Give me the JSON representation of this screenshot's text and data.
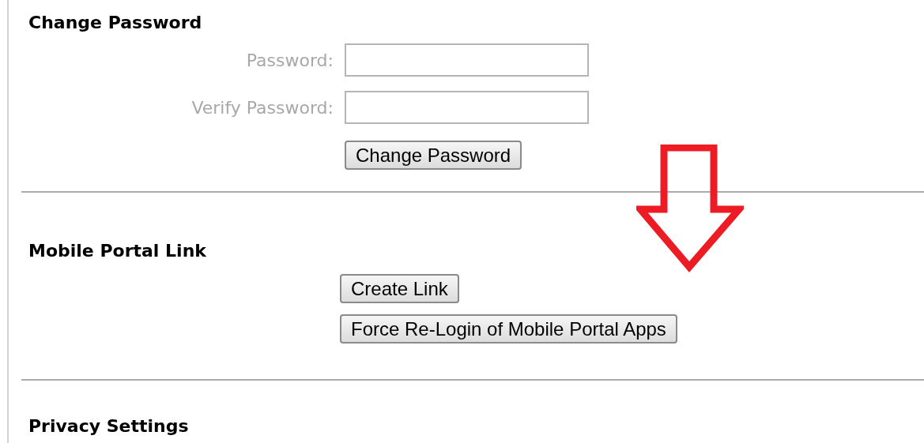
{
  "sections": [
    {
      "title": "Change Password",
      "fields": [
        {
          "label": "Password:"
        },
        {
          "label": "Verify Password:"
        }
      ],
      "buttons": [
        "Change Password"
      ]
    },
    {
      "title": "Mobile Portal Link",
      "buttons": [
        "Create Link",
        "Force Re-Login of Mobile Portal Apps"
      ]
    },
    {
      "title": "Privacy Settings"
    }
  ]
}
